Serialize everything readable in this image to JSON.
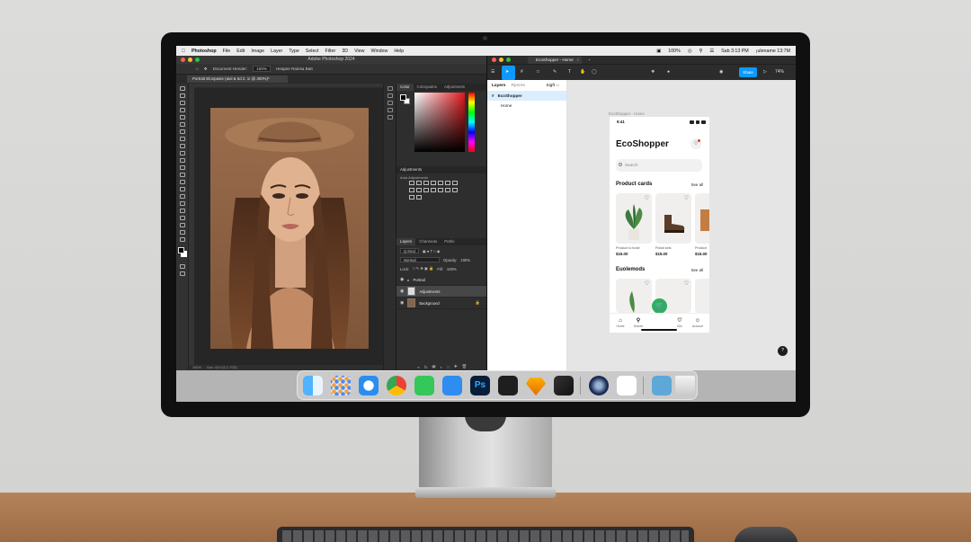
{
  "menubar": {
    "app": "Photoshop",
    "items": [
      "File",
      "Edit",
      "Image",
      "Layer",
      "Type",
      "Select",
      "Filter",
      "3D",
      "View",
      "Window",
      "Help"
    ],
    "battery": "100%",
    "datetime": "Sab 3:13 PM",
    "user": "¡ulename 13:7M"
  },
  "photoshop": {
    "window_title": "Adobe Photoshop 2024",
    "options": {
      "zoom_label": "Document Hender:",
      "zoom_value": "100%",
      "checkbox_label": "Heapse Rainsa Batt"
    },
    "doc_tab": "Portrait Elonpaste (aiol & 5d 2. 1I @ 300%)*",
    "status": "100%",
    "status_doc": "Doc: 43.0 (0.2 7/33)",
    "panel_tabs": [
      {
        "label": "Color",
        "active": true
      },
      {
        "label": "Colorpadns",
        "active": false
      },
      {
        "label": "Adjusrsents",
        "active": false
      }
    ],
    "adjustments": {
      "title": "Adjustments",
      "subtitle": "Auta Adjustmente"
    },
    "layers_tabs": [
      {
        "label": "Layers",
        "active": true
      },
      {
        "label": "Channeas",
        "active": false
      },
      {
        "label": "Pathe",
        "active": false
      }
    ],
    "layers_kind": "Q Kind",
    "blend_mode": "Normal",
    "opacity_label": "Opacity:",
    "opacity_value": "100%",
    "lock_label": "Lock:",
    "fill_label": "Fill:",
    "fill_value": "100%",
    "layers": [
      {
        "name": "Portrail",
        "kind": "folder",
        "selected": false
      },
      {
        "name": "Adjustments",
        "kind": "adjustment",
        "selected": true
      },
      {
        "name": "Background",
        "kind": "image",
        "selected": false
      }
    ]
  },
  "figma": {
    "tab_title": "EcoShopper - Home",
    "share_label": "Share",
    "zoom_label": "74%",
    "left_tabs": {
      "layers": "Layers",
      "assets": "Rpnres",
      "page": "Sigft ⌵"
    },
    "pages": [
      {
        "name": "EcoShopper",
        "selected": true
      },
      {
        "name": "Home",
        "selected": false
      }
    ],
    "frame_label": "EcoShopper - Home",
    "help": "?"
  },
  "app_preview": {
    "time": "9:41",
    "title": "EcoShopper",
    "search_placeholder": "Search",
    "section1": "Product cards",
    "section1_link": "See all",
    "products": [
      {
        "name": "Product Io toole",
        "price": "$15.00"
      },
      {
        "name": "Pdoid sels",
        "price": "$15.00"
      },
      {
        "name": "Product",
        "price": "$15.00"
      }
    ],
    "section2": "Euolemods",
    "section2_link": "See all",
    "nav": [
      "Home",
      "Search",
      "Kiki",
      "Account"
    ]
  },
  "dock": {
    "apps": [
      "finder",
      "launchpad",
      "safari",
      "chrome",
      "messages",
      "mail",
      "photoshop",
      "figma",
      "sketch",
      "final-cut",
      "cinema4d",
      "slack",
      "downloads-folder",
      "trash"
    ]
  },
  "colors": {
    "figma_accent": "#0d99ff",
    "app_green": "#2fae63",
    "ps_panel": "#2e2e2e"
  }
}
